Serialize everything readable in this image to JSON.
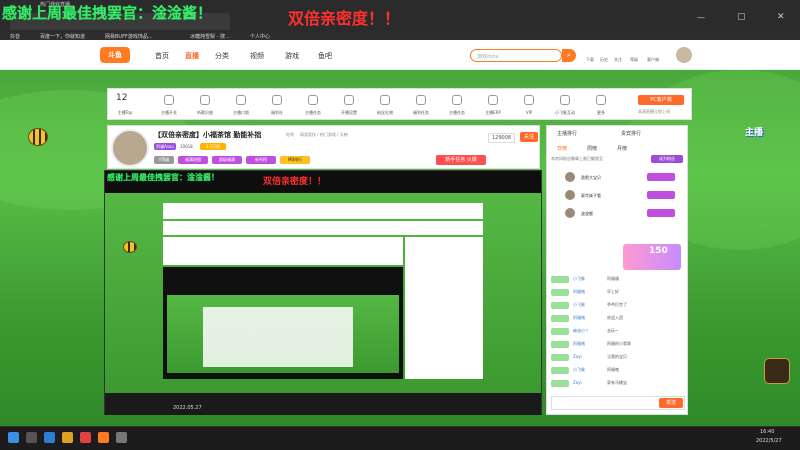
{
  "browser": {
    "tab_title": "热门游戏直播",
    "bookmarks": [
      "抖音",
      "百度一下，你就知道",
      "网易BUFF游戏饰品...",
      "冰糖炖雪梨 - 搜...",
      "个人中心"
    ]
  },
  "overlay": {
    "thanks_text": "感谢上周最佳拽罢官：淦淦酱！",
    "double_text": "双倍亲密度！！"
  },
  "site_nav": {
    "items": [
      "首页",
      "直播",
      "分类",
      "视频",
      "游戏",
      "鱼吧"
    ],
    "search_placeholder": "游戏dota",
    "user_items": [
      "下载",
      "历史",
      "关注",
      "等级",
      "开播",
      "客户端",
      "个人中心"
    ]
  },
  "categories": {
    "count": "12",
    "count_label": "主播Top",
    "items": [
      "主播开关",
      "听歌识曲",
      "主播口袋",
      "福利社",
      "主播任务",
      "开播设置",
      "粉丝礼物",
      "福利任务",
      "主播任务",
      "主播ERP",
      "VIP",
      "小飞象互动",
      "更多"
    ],
    "pc_button": "PC客户端",
    "pc_sub": "高清直播立即上线"
  },
  "room": {
    "title": "【双倍亲密度】小福茶馆 勤能补拙",
    "meta_left": "吃鸡",
    "meta_mid": "网游竞技 / 热门游戏 / 天梯",
    "host_name": "阿福Asou",
    "host_count": "10018",
    "like_label": "1.2万粉",
    "follow_count": "129008",
    "follow_label": "关注",
    "badges": [
      "福满地图",
      "超级福满",
      "新秀榜",
      "MB排行"
    ],
    "newbie": "新手任务 火爆"
  },
  "side": {
    "rank_title": "主播排行",
    "rank_sub": "贵宾排行",
    "tabs": [
      "日榜",
      "周榜",
      "月榜"
    ],
    "notice": "本房间粉丝徽章上限已解锁至",
    "top_users": [
      {
        "name": "敖肥大宝贝",
        "rank": "1"
      },
      {
        "name": "豪华妹子看",
        "rank": "2"
      },
      {
        "name": "波波搬",
        "rank": "3"
      }
    ],
    "chat": [
      {
        "user": "小飞象",
        "text": "阿福福"
      },
      {
        "user": "阿福咯",
        "text": "早上好"
      },
      {
        "user": "小飞象",
        "text": "爷爷打完了"
      },
      {
        "user": "阿福咯",
        "text": "欢迎入团"
      },
      {
        "user": "麻油小丫",
        "text": "去玩~"
      },
      {
        "user": "阿福咯",
        "text": "阿福的小翡翠"
      },
      {
        "user": "Zoyi",
        "text": "当我的宝贝"
      },
      {
        "user": "小飞象",
        "text": "阿福咯"
      },
      {
        "user": "Zoyi",
        "text": "家有马桶宝"
      }
    ],
    "gift_count": "150",
    "send_button": "发送"
  },
  "stream_meta": {
    "timestamp": "2022.05.27",
    "clock": "16:40"
  },
  "taskbar": {
    "time": "16:40",
    "date": "2022/5/27"
  },
  "colors": {
    "accent": "#ff6a2a",
    "grass": "#4aa83a",
    "overlay_green": "#3ee86d",
    "overlay_red": "#ff3030",
    "purple": "#9b4fd6"
  }
}
